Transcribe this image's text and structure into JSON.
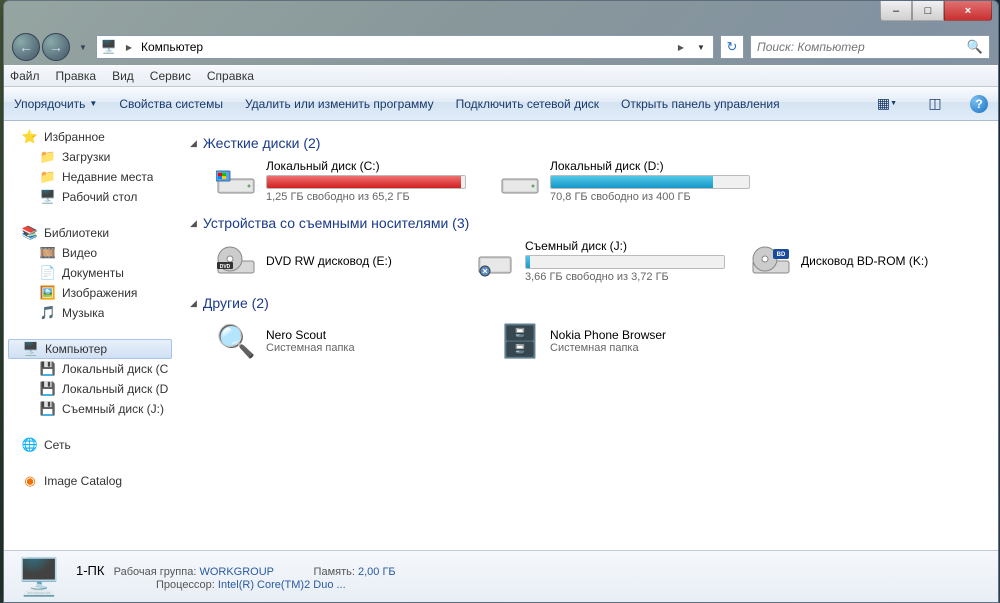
{
  "title_buttons": {
    "min": "–",
    "max": "□",
    "close": "×"
  },
  "address": {
    "text": "Компьютер",
    "arrow": "▶"
  },
  "search": {
    "placeholder": "Поиск: Компьютер"
  },
  "menu": [
    "Файл",
    "Правка",
    "Вид",
    "Сервис",
    "Справка"
  ],
  "toolbar": {
    "organize": "Упорядочить",
    "items": [
      "Свойства системы",
      "Удалить или изменить программу",
      "Подключить сетевой диск",
      "Открыть панель управления"
    ]
  },
  "sidebar": {
    "favorites": {
      "label": "Избранное",
      "items": [
        "Загрузки",
        "Недавние места",
        "Рабочий стол"
      ]
    },
    "libraries": {
      "label": "Библиотеки",
      "items": [
        "Видео",
        "Документы",
        "Изображения",
        "Музыка"
      ]
    },
    "computer": {
      "label": "Компьютер",
      "items": [
        "Локальный диск (C:)",
        "Локальный диск (D:)",
        "Съемный диск (J:)"
      ]
    },
    "network": {
      "label": "Сеть"
    },
    "image_catalog": {
      "label": "Image Catalog"
    }
  },
  "groups": {
    "hdd": {
      "title": "Жесткие диски (2)",
      "drives": [
        {
          "label": "Локальный диск (C:)",
          "sub": "1,25 ГБ свободно из 65,2 ГБ",
          "fill": 98,
          "red": true
        },
        {
          "label": "Локальный диск (D:)",
          "sub": "70,8 ГБ свободно из 400 ГБ",
          "fill": 82,
          "red": false
        }
      ]
    },
    "removable": {
      "title": "Устройства со съемными носителями (3)",
      "items": [
        {
          "label": "DVD RW дисковод (E:)",
          "type": "dvd"
        },
        {
          "label": "Съемный диск (J:)",
          "sub": "3,66 ГБ свободно из 3,72 ГБ",
          "fill": 2,
          "type": "usb"
        },
        {
          "label": "Дисковод BD-ROM (K:)",
          "type": "bd"
        }
      ]
    },
    "other": {
      "title": "Другие (2)",
      "items": [
        {
          "label": "Nero Scout",
          "sub": "Системная папка"
        },
        {
          "label": "Nokia Phone Browser",
          "sub": "Системная папка"
        }
      ]
    }
  },
  "details": {
    "name": "1-ПК",
    "wg_label": "Рабочая группа:",
    "wg_val": "WORKGROUP",
    "mem_label": "Память:",
    "mem_val": "2,00 ГБ",
    "cpu_label": "Процессор:",
    "cpu_val": "Intel(R) Core(TM)2 Duo ..."
  }
}
